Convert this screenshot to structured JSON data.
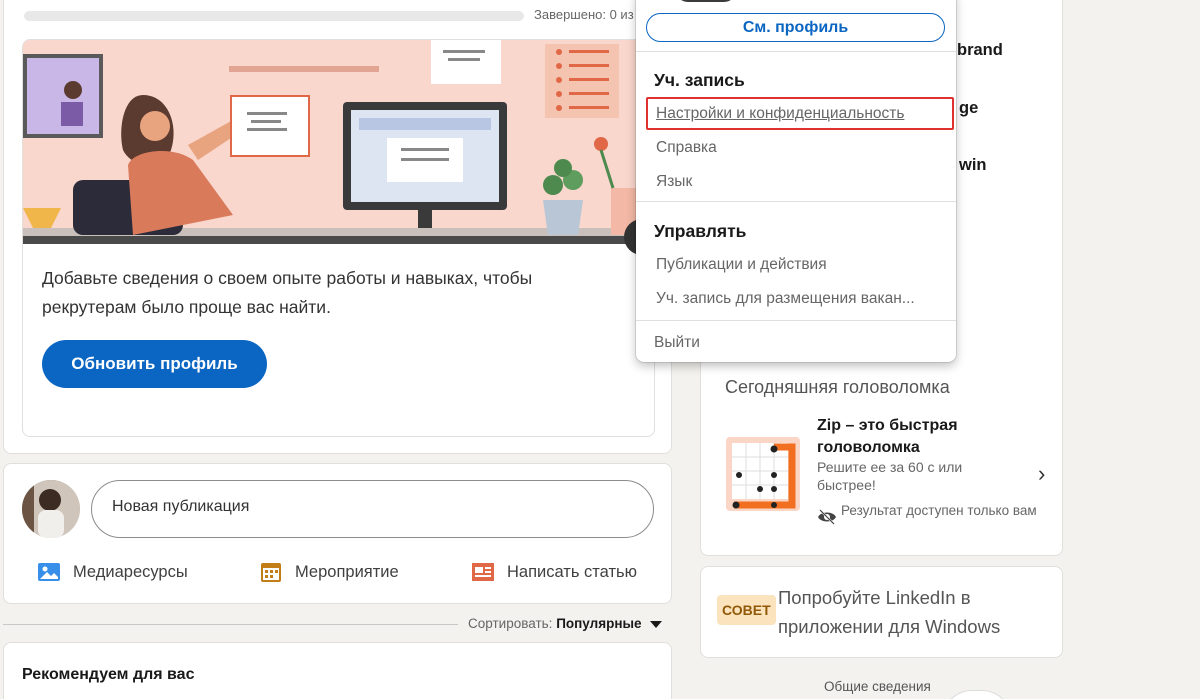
{
  "progress": {
    "label": "Завершено: 0 из",
    "value_percent": 0
  },
  "profile_card": {
    "text": "Добавьте сведения о своем опыте работы и навыках, чтобы рекрутерам было проще вас найти.",
    "button": "Обновить профиль"
  },
  "post": {
    "placeholder": "Новая публикация",
    "actions": [
      {
        "label": "Медиаресурсы",
        "icon": "image-icon",
        "color": "#378fe9"
      },
      {
        "label": "Мероприятие",
        "icon": "calendar-icon",
        "color": "#c37d16"
      },
      {
        "label": "Написать статью",
        "icon": "article-icon",
        "color": "#e06847"
      }
    ]
  },
  "sort": {
    "label": "Сортировать:",
    "value": "Популярные"
  },
  "recommend": {
    "title": "Рекомендуем для вас"
  },
  "right_partial": [
    "brand",
    "ge",
    "win"
  ],
  "puzzle": {
    "section_title": "Сегодняшняя головоломка",
    "title": "Zip – это быстрая головоломка",
    "subtitle": "Решите ее за 60 с или быстрее!",
    "result_note": "Результат доступен только вам"
  },
  "windows_promo": {
    "badge": "СОВЕТ",
    "text": "Попробуйте LinkedIn в приложении для Windows"
  },
  "footer": {
    "link": "Общие сведения"
  },
  "menu": {
    "see_profile": "См. профиль",
    "account_header": "Уч. запись",
    "account_items": [
      "Настройки и конфиденциальность",
      "Справка",
      "Язык"
    ],
    "manage_header": "Управлять",
    "manage_items": [
      "Публикации и действия",
      "Уч. запись для размещения вакан..."
    ],
    "sign_out": "Выйти"
  },
  "colors": {
    "accent": "#0a66c2",
    "highlight": "#e03131",
    "badge_bg": "#fbe3bd"
  }
}
